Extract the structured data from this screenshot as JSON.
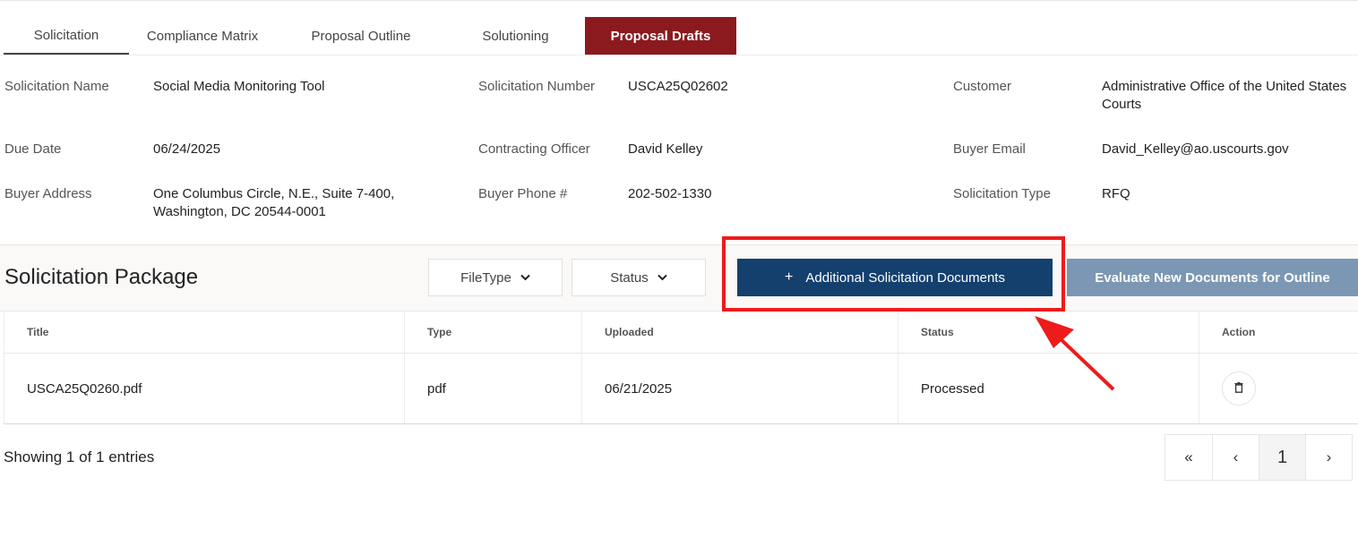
{
  "tabs": [
    {
      "label": "Solicitation"
    },
    {
      "label": "Compliance Matrix"
    },
    {
      "label": "Proposal Outline"
    },
    {
      "label": "Solutioning"
    },
    {
      "label": "Proposal Drafts"
    }
  ],
  "info": {
    "solicitation_name_label": "Solicitation Name",
    "solicitation_name": "Social Media Monitoring Tool",
    "solicitation_number_label": "Solicitation Number",
    "solicitation_number": "USCA25Q02602",
    "customer_label": "Customer",
    "customer_line1": "Administrative Office of the United States",
    "customer_line2": "Courts",
    "due_date_label": "Due Date",
    "due_date": "06/24/2025",
    "contracting_officer_label": "Contracting Officer",
    "contracting_officer": "David Kelley",
    "buyer_email_label": "Buyer Email",
    "buyer_email": "David_Kelley@ao.uscourts.gov",
    "buyer_address_label": "Buyer Address",
    "buyer_address_line1": "One Columbus Circle, N.E., Suite 7-400,",
    "buyer_address_line2": "Washington, DC 20544-0001",
    "buyer_phone_label": "Buyer Phone #",
    "buyer_phone": "202-502-1330",
    "solicitation_type_label": "Solicitation Type",
    "solicitation_type": "RFQ"
  },
  "package": {
    "title": "Solicitation Package",
    "filetype_label": "FileType",
    "status_label": "Status",
    "add_docs_plus": "+",
    "add_docs_label": "Additional Solicitation Documents",
    "evaluate_label": "Evaluate New Documents for Outline"
  },
  "table": {
    "headers": [
      "Title",
      "Type",
      "Uploaded",
      "Status",
      "Action"
    ],
    "rows": [
      {
        "title": "USCA25Q0260.pdf",
        "type": "pdf",
        "uploaded": "06/21/2025",
        "status": "Processed"
      }
    ]
  },
  "footer": {
    "showing": "Showing 1 of 1 entries",
    "pager_first": "«",
    "pager_prev": "‹",
    "pager_current": "1",
    "pager_next": "›"
  },
  "colors": {
    "accent_red": "#8b1a1f",
    "primary_blue": "#14406e",
    "disabled_blue": "#7c97b3",
    "highlight_red": "#ee1b1b"
  }
}
